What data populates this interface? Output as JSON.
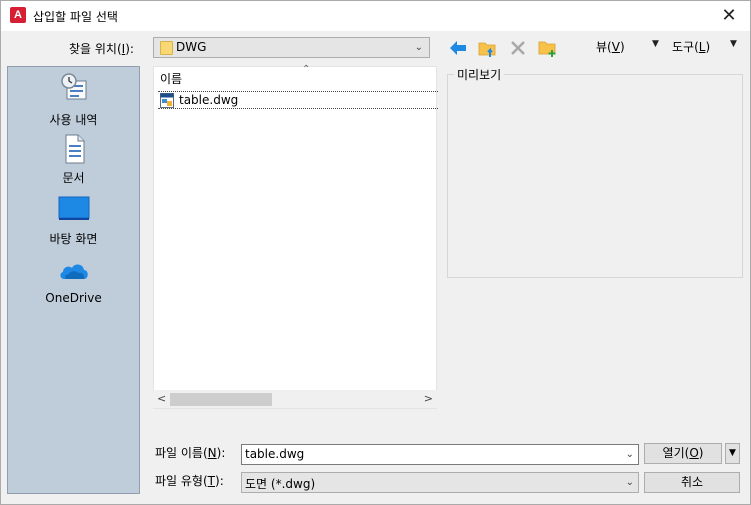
{
  "window": {
    "title": "삽입할 파일 선택",
    "app_icon": "A",
    "close_glyph": "✕"
  },
  "lookin": {
    "label": "찾을 위치(",
    "accel": "I",
    "label_end": "):",
    "value": "DWG"
  },
  "toolbar": {
    "icons": [
      "back-arrow-icon",
      "up-folder-icon",
      "delete-x-icon",
      "new-folder-icon"
    ],
    "view_label": "뷰(",
    "view_accel": "V",
    "view_end": ")",
    "tools_label": "도구(",
    "tools_accel": "L",
    "tools_end": ")"
  },
  "places": [
    {
      "label": "사용 내역",
      "icon": "history-icon"
    },
    {
      "label": "문서",
      "icon": "documents-icon"
    },
    {
      "label": "바탕 화면",
      "icon": "desktop-icon"
    },
    {
      "label": "OneDrive",
      "icon": "onedrive-icon"
    }
  ],
  "filelist": {
    "column_header": "이름",
    "files": [
      {
        "name": "table.dwg",
        "icon": "dwg-file-icon"
      }
    ]
  },
  "preview": {
    "title": "미리보기"
  },
  "filename": {
    "label": "파일 이름(",
    "accel": "N",
    "label_end": "):",
    "value": "table.dwg"
  },
  "filetype": {
    "label": "파일 유형(",
    "accel": "T",
    "label_end": "):",
    "value": "도면 (*.dwg)"
  },
  "buttons": {
    "open_label": "열기(",
    "open_accel": "O",
    "open_end": ")",
    "cancel_label": "취소"
  },
  "colors": {
    "places_bg": "#bfcddb",
    "accent_blue": "#1e88e5",
    "folder_yellow": "#f8c14a",
    "app_red": "#d71f33"
  }
}
